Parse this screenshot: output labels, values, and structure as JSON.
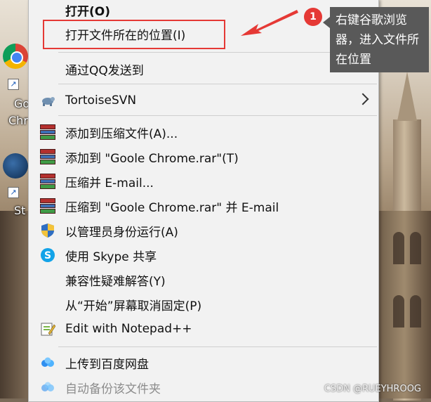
{
  "desktop": {
    "icons": [
      {
        "label": "Go",
        "label2": "Chr"
      },
      {
        "label": "St"
      }
    ]
  },
  "menu": {
    "items": [
      {
        "label": "打开(O)"
      },
      {
        "label": "打开文件所在的位置(I)"
      },
      {
        "label": "通过QQ发送到"
      },
      {
        "label": "TortoiseSVN"
      },
      {
        "label": "添加到压缩文件(A)..."
      },
      {
        "label": "添加到 \"Goole Chrome.rar\"(T)"
      },
      {
        "label": "压缩并 E-mail..."
      },
      {
        "label": "压缩到 \"Goole Chrome.rar\" 并 E-mail"
      },
      {
        "label": "以管理员身份运行(A)"
      },
      {
        "label": "使用 Skype 共享"
      },
      {
        "label": "兼容性疑难解答(Y)"
      },
      {
        "label": "从“开始”屏幕取消固定(P)"
      },
      {
        "label": "Edit with Notepad++"
      },
      {
        "label": "上传到百度网盘"
      },
      {
        "label": "自动备份该文件夹"
      }
    ]
  },
  "annotation": {
    "step": "1",
    "callout_text": "右键谷歌浏览器，进入文件所在位置",
    "highlight_color": "#e53935"
  },
  "watermark": "CSDN @RUEYHROOG"
}
